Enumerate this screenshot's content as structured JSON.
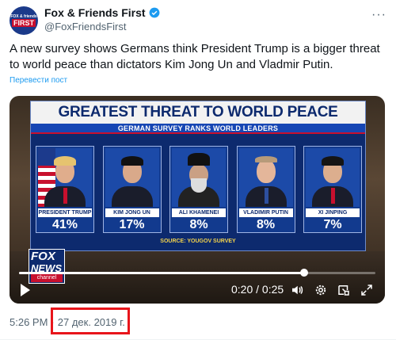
{
  "author": {
    "display_name": "Fox & Friends First",
    "handle": "@FoxFriendsFirst",
    "avatar_text_top": "FOX & friends",
    "avatar_text_bottom": "FIRST"
  },
  "tweet": {
    "text": "A new survey shows Germans think President Trump is a bigger threat to world peace than dictators Kim Jong Un and Vladmir Putin.",
    "translate_label": "Перевести пост"
  },
  "video": {
    "headline": "GREATEST THREAT TO WORLD PEACE",
    "subheadline": "GERMAN SURVEY RANKS WORLD LEADERS",
    "source": "SOURCE: YOUGOV SURVEY",
    "leaders": [
      {
        "name": "PRESIDENT TRUMP",
        "percent": "41%"
      },
      {
        "name": "KIM JONG UN",
        "percent": "17%"
      },
      {
        "name": "ALI KHAMENEI",
        "percent": "8%"
      },
      {
        "name": "VLADIMIR PUTIN",
        "percent": "8%"
      },
      {
        "name": "XI JINPING",
        "percent": "7%"
      }
    ],
    "logo_line1": "FOX",
    "logo_line2": "NEWS",
    "logo_line3": "channel",
    "time_display": "0:20 / 0:25",
    "progress_fraction": 0.8
  },
  "timestamp": {
    "time": "5:26 PM",
    "separator": "·",
    "date": "27 дек. 2019 г."
  },
  "colors": {
    "accent": "#1d9bf0",
    "verified": "#1d9bf0",
    "highlight": "#e8151b"
  }
}
